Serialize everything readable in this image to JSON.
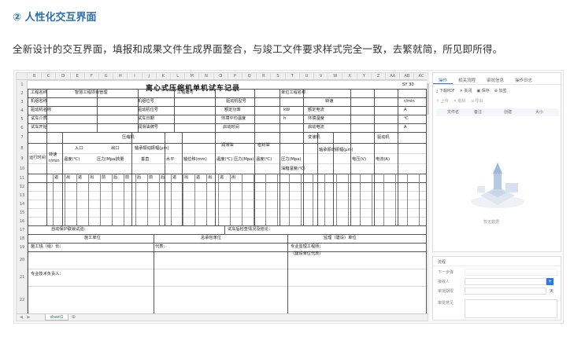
{
  "heading": "② 人性化交互界面",
  "description": "全新设计的交互界面，填报和成果文件生成界面整合，与竣工文件要求样式完全一致，去繁就简，所见即所得。",
  "sheet": {
    "title": "离心式压缩机单机试车记录",
    "code": "SY 30",
    "columns": [
      "B",
      "C",
      "D",
      "E",
      "F",
      "G",
      "H",
      "I",
      "J",
      "K",
      "L",
      "M",
      "N",
      "O",
      "P",
      "Q",
      "R",
      "S",
      "T",
      "U",
      "V",
      "W",
      "X",
      "Y",
      "Z",
      "AA",
      "AB",
      "AC"
    ],
    "rows": [
      "1",
      "2",
      "3",
      "4",
      "5",
      "6",
      "7",
      "8",
      "9",
      "10",
      "11",
      "12",
      "13",
      "14",
      "15",
      "16",
      "17",
      "18",
      "19",
      "20",
      "21",
      "22"
    ],
    "r2": {
      "project_name": "工程名称",
      "project_value": "智慧工程项目管理",
      "project_no": "工程编号",
      "unit_project": "单位工程名称"
    },
    "r3": {
      "unit_name": "机组名称",
      "model": "机组位号",
      "model_type": "驱动机型号",
      "speed": "转速",
      "speed_unit": "r/min"
    },
    "r4": {
      "drive_name": "驱动机名称",
      "drive_no": "驱动机位号",
      "rated": "额定功率",
      "kw": "kW",
      "rated_current": "额定电流",
      "a": "A"
    },
    "r5": {
      "medium": "试车介质",
      "date": "试车日期",
      "ambient": "环境平均温度",
      "h": "h",
      "temp": "环境温度",
      "c": "℃"
    },
    "r6": {
      "start": "试车开始",
      "lube": "润滑油牌号",
      "run_time": "启动时间",
      "stop_time": "启动电流",
      "a": "A"
    },
    "r7": {
      "compressor": "压缩机",
      "lube_oil": "润滑油",
      "seal_oil": "密封油",
      "gearbox": "变速机",
      "motor": "驱动机"
    },
    "r8": {
      "time": "运行时间",
      "speed": "转速",
      "speed_unit": "r/min",
      "inlet": "入口",
      "outlet": "出口",
      "vib": "轴承振动振幅(μm)",
      "temp": "温度(℃)",
      "pressure": "压力(Mpa)",
      "flow": "流量",
      "vert": "垂直",
      "horiz": "水平",
      "axial": "轴位移(mm)",
      "oil_temp": "温度(℃)",
      "oil_press": "压力(Mpa)",
      "seal_temp": "温度(℃)",
      "seal_press": "压力(Mpa)",
      "gear_temp": "油箱温度(℃)",
      "gear_vib": "轴承振动振幅(μm)",
      "voltage": "电压(V)",
      "current": "电流(A)"
    },
    "r11": [
      "进",
      "出",
      "进",
      "出",
      "前",
      "后",
      "前",
      "后",
      "前",
      "后",
      "进",
      "出",
      "进",
      "出",
      "进",
      "出"
    ],
    "r16": {
      "self_check": "自动保护联锁试验：",
      "instrument": "试车后检查情况及结论："
    },
    "r18": {
      "builder": "施工单位",
      "owner": "总承包单位",
      "supervisor": "监理（建设）单位"
    },
    "r19": {
      "team": "施工班（组）长：",
      "rep": "代表：",
      "sup": "专业监理工程师："
    },
    "r20": {
      "sup2": "（建设单位代表）"
    },
    "r21": {
      "tech": "专业技术负责人："
    },
    "tab": "sheet1"
  },
  "panel": {
    "tabs": [
      "操作",
      "相关流程",
      "审批信息",
      "操作日志"
    ],
    "tools": [
      "下载PDF",
      "关闭",
      "保存",
      "加签"
    ],
    "tools2": [
      "上传",
      "删除",
      "导出"
    ],
    "table_headers": [
      "文件名",
      "备注",
      "创建",
      "大小"
    ],
    "empty_text": "暂无数据"
  },
  "form": {
    "title": "流程",
    "step_label": "下一步骤",
    "assignee_label": "接收人",
    "deadline_label": "审批期限",
    "deadline_unit": "天",
    "opinion_label": "审批意见",
    "add_btn": "+"
  }
}
